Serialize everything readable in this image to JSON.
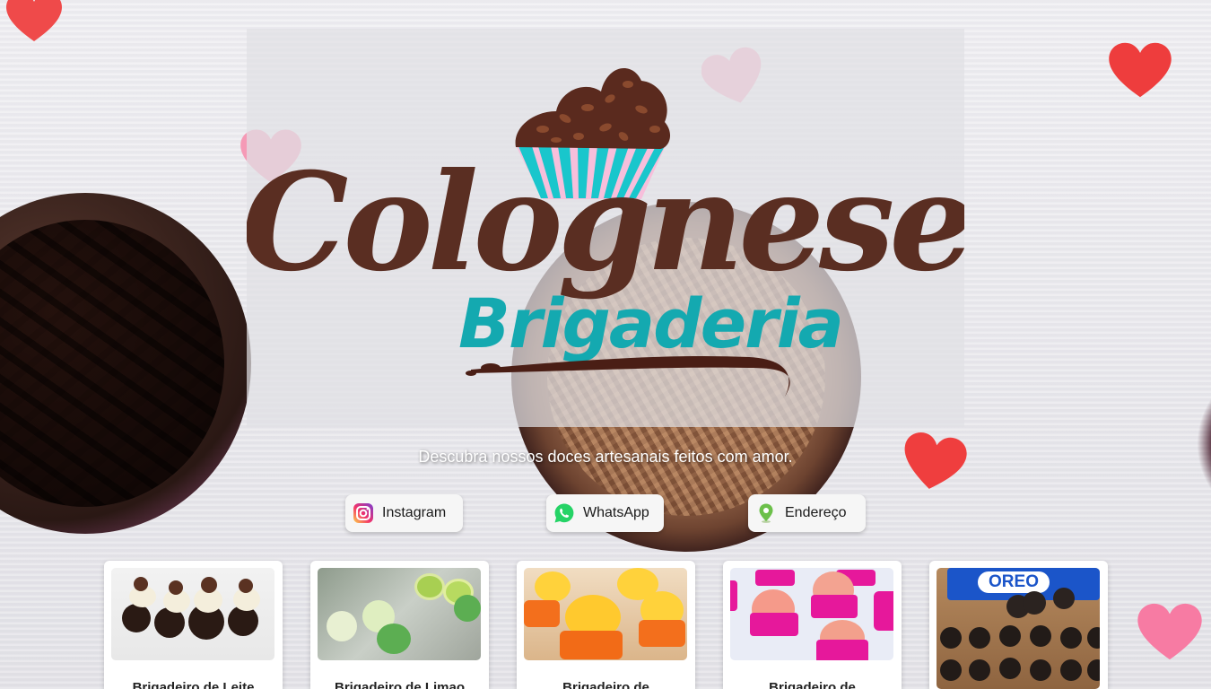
{
  "brand": {
    "name": "Colognese",
    "subtitle": "Brigaderia"
  },
  "tagline": "Descubra nossos doces artesanais feitos com amor.",
  "social": [
    {
      "label": "Instagram",
      "icon": "instagram-icon"
    },
    {
      "label": "WhatsApp",
      "icon": "whatsapp-icon"
    },
    {
      "label": "Endereço",
      "icon": "location-pin-icon"
    }
  ],
  "products": [
    {
      "title": "Brigadeiro de Leite"
    },
    {
      "title": "Brigadeiro de Limao"
    },
    {
      "title": "Brigadeiro de"
    },
    {
      "title": "Brigadeiro de"
    },
    {
      "title": ""
    }
  ],
  "product_photo_text": {
    "oreo": "OREO"
  },
  "colors": {
    "brown": "#5a2e22",
    "teal": "#14a9b0",
    "pink": "#f5b8d3"
  }
}
